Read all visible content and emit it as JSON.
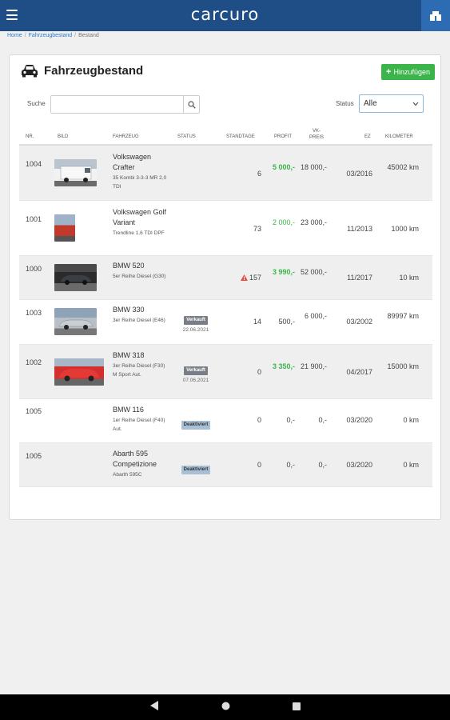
{
  "app": {
    "logo": "carcuro"
  },
  "breadcrumb": {
    "home": "Home",
    "fahrzeugbestand": "Fahrzeugbestand",
    "current": "Bestand",
    "sep": "/"
  },
  "card": {
    "title": "Fahrzeugbestand",
    "add_label": "Hinzufügen"
  },
  "search": {
    "label": "Suche",
    "value": "",
    "placeholder": ""
  },
  "status_filter": {
    "label": "Status",
    "selected": "Alle"
  },
  "table": {
    "headers": {
      "nr": "NR.",
      "bild": "BILD",
      "fahrzeug": "FAHRZEUG",
      "status": "STATUS",
      "standtage": "STANDTAGE",
      "profit": "PROFIT",
      "vk_preis_1": "VK-",
      "vk_preis_2": "PREIS",
      "ez": "EZ",
      "kilometer": "KILOMETER"
    },
    "rows": [
      {
        "nr": "1004",
        "model": "Volkswagen Crafter",
        "sub": "35 Kombi 3-3-3 MR 2,0 TDI",
        "status": "",
        "date": "",
        "standtage": "6",
        "profit": "5 000,-",
        "vk": "18 000,-",
        "ez": "03/2016",
        "km": "45002 km"
      },
      {
        "nr": "1001",
        "model": "Volkswagen Golf Variant",
        "sub": "Trendline 1,6 TDI DPF",
        "status": "",
        "date": "",
        "standtage": "73",
        "profit": "2 000,-",
        "vk": "23 000,-",
        "ez": "11/2013",
        "km": "1000 km"
      },
      {
        "nr": "1000",
        "model": "BMW 520",
        "sub": "5er Reihe Diesel (G30)",
        "status": "",
        "date": "",
        "standtage": "157",
        "profit": "3 990,-",
        "vk": "52 000,-",
        "ez": "11/2017",
        "km": "10 km"
      },
      {
        "nr": "1003",
        "model": "BMW 330",
        "sub": "3er Reihe Diesel (E46)",
        "status": "Verkauft",
        "date": "22.06.2021",
        "standtage": "14",
        "profit": "500,-",
        "vk": "6 000,-",
        "ez": "03/2002",
        "km": "89997 km"
      },
      {
        "nr": "1002",
        "model": "BMW 318",
        "sub": "3er Reihe Diesel (F30) M Sport Aut.",
        "status": "Verkauft",
        "date": "07.06.2021",
        "standtage": "0",
        "profit": "3 350,-",
        "vk": "21 900,-",
        "ez": "04/2017",
        "km": "15000 km"
      },
      {
        "nr": "1005",
        "model": "BMW 116",
        "sub": "1er Reihe Diesel (F40) Aut.",
        "status": "Deaktiviert",
        "date": "",
        "standtage": "0",
        "profit": "0,-",
        "vk": "0,-",
        "ez": "03/2020",
        "km": "0 km"
      },
      {
        "nr": "1005",
        "model": "Abarth 595 Competizione",
        "sub": "Abarth 595C",
        "status": "Deaktiviert",
        "date": "",
        "standtage": "0",
        "profit": "0,-",
        "vk": "0,-",
        "ez": "03/2020",
        "km": "0 km"
      }
    ]
  },
  "colors": {
    "header": "#1f4e86",
    "accent": "#2d6bb3",
    "add_button": "#3bb54a",
    "profit_green": "#3bb54a",
    "badge_sold": "#7a7f87",
    "badge_deactivated": "#a8c0d6"
  }
}
